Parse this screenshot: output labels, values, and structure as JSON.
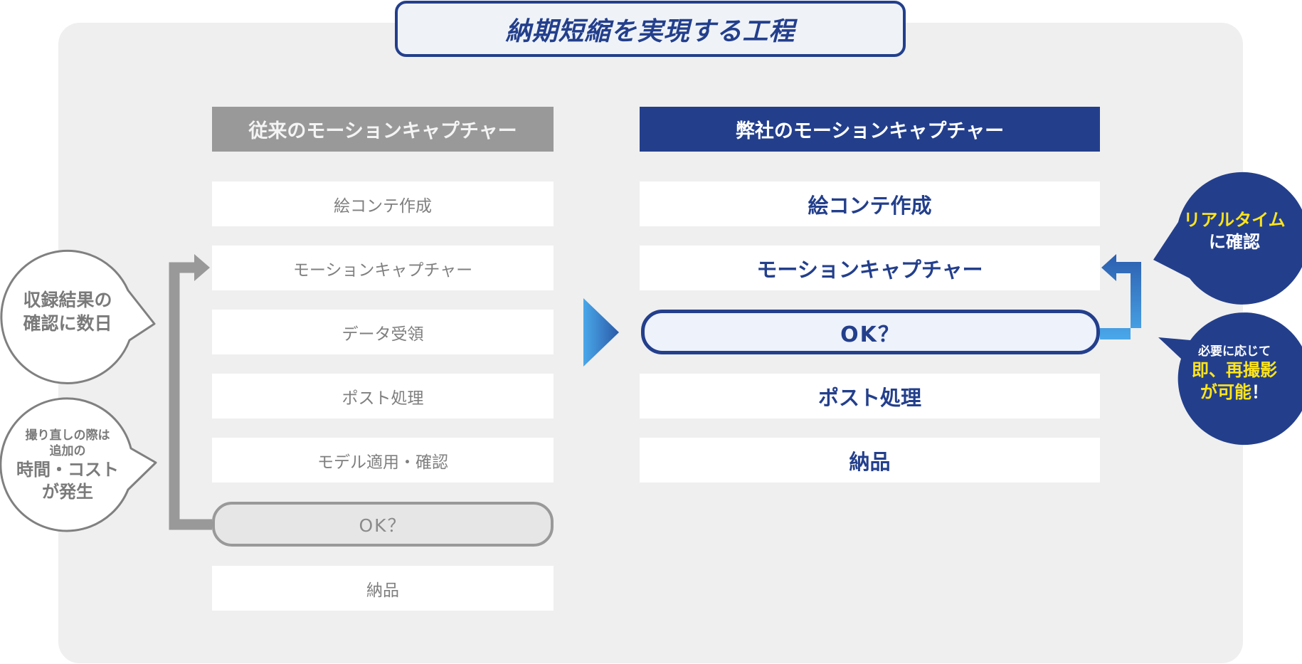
{
  "title": "納期短縮を実現する工程",
  "colors": {
    "brand_navy": "#233f8c",
    "gray_header": "#999999",
    "panel_bg": "#efefef",
    "highlight_yellow": "#ffe51a",
    "arrow_light_blue": "#4aa8ea"
  },
  "conventional": {
    "header": "従来のモーションキャプチャー",
    "steps": [
      "絵コンテ作成",
      "モーションキャプチャー",
      "データ受領",
      "ポスト処理",
      "モデル適用・確認"
    ],
    "check_step": "OK？",
    "final_step": "納品",
    "bubbles": [
      {
        "lines": [
          "収録結果の",
          "確認に数日"
        ]
      },
      {
        "lines": [
          "撮り直しの際は",
          "追加の",
          "時間・コスト",
          "が発生"
        ]
      }
    ]
  },
  "ours": {
    "header": "弊社のモーションキャプチャー",
    "steps_before": [
      "絵コンテ作成",
      "モーションキャプチャー"
    ],
    "check_step": "OK？",
    "steps_after": [
      "ポスト処理",
      "納品"
    ],
    "bubbles": [
      {
        "highlight": "リアルタイム",
        "rest": "に確認"
      },
      {
        "intro": "必要に応じて",
        "highlight_1": "即、再撮影",
        "highlight_2": "が可能",
        "suffix": "！"
      }
    ]
  },
  "icons": {
    "transition": "triangle-right-arrow-icon",
    "loop_back_left": "elbow-arrow-gray-icon",
    "loop_back_right": "elbow-arrow-blue-icon"
  }
}
